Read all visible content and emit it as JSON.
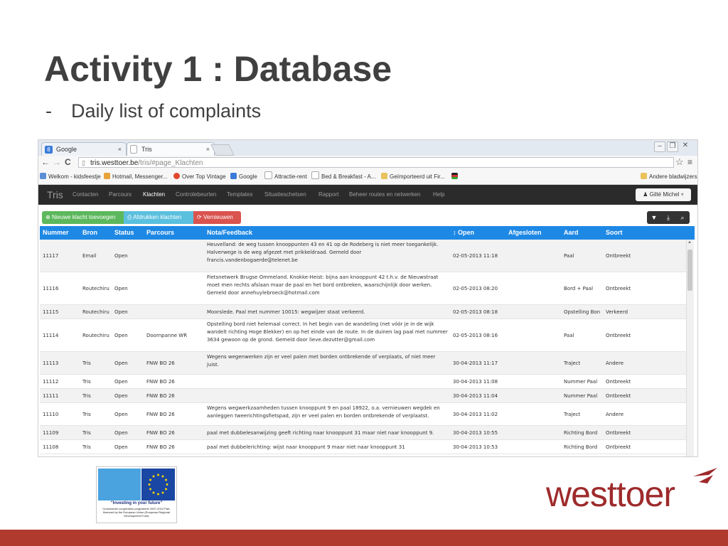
{
  "slide": {
    "title": "Activity 1 : Database",
    "bullet_dash": "-",
    "bullet": "Daily list of complaints"
  },
  "browser": {
    "tabs": [
      {
        "label": "Google",
        "favicon": "google-icon",
        "close": "×"
      },
      {
        "label": "Tris",
        "favicon": "page-icon",
        "close": "×"
      }
    ],
    "url_host": "tris.westtoer.be",
    "url_path": "/tris/#page_Klachten",
    "bookmarks": [
      "Welkom - kidsfeestje",
      "Hotmail, Messenger...",
      "Over Top Vintage",
      "Google",
      "Attractie-rent",
      "Bed & Breakfast - A...",
      "Geïmporteerd uit Fir...",
      "Andere bladwijzers"
    ]
  },
  "app": {
    "brand": "Tris",
    "menu": [
      "Contacten",
      "Parcours",
      "Klachten",
      "Controlebeurten",
      "Templates",
      "Situatieschetsen",
      "Rapport",
      "Beheer routes en netwerken",
      "Help"
    ],
    "active_menu": "Klachten",
    "user": "Gilté Michel",
    "buttons": {
      "new": "Nieuwe klacht toevoegen",
      "print": "Afdrukken klachten",
      "refresh": "Vernieuwen"
    }
  },
  "table": {
    "columns": [
      "Nummer",
      "Bron",
      "Status",
      "Parcours",
      "Nota/Feedback",
      "Open",
      "Afgesloten",
      "Aard",
      "Soort"
    ],
    "rows": [
      {
        "nummer": "11117",
        "bron": "Email",
        "status": "Open",
        "parcours": "",
        "nota": "Heuvelland: de weg tussen knooppunten 43 en 41 op de Rodeberg is niet meer toegankelijk. Halverwege is de weg afgezet met prikkeldraad. Gemeld door francis.vandenbogaerde@telenet.be",
        "open": "02-05-2013 11:18",
        "afgesloten": "",
        "aard": "Paal",
        "soort": "Ontbreekt"
      },
      {
        "nummer": "11116",
        "bron": "Routechiru",
        "status": "Open",
        "parcours": "",
        "nota": "Fietsnetwerk Brugse Ommeland. Knokke-Heist: bijna aan knooppunt 42 t.h.v. de Nieuwstraat moet men rechts afslaan maar de paal en het bord ontbreken, waarschijnlijk door werken. Gemeld door annehuylebroeck@hotmail.com",
        "open": "02-05-2013 08:20",
        "afgesloten": "",
        "aard": "Bord + Paal",
        "soort": "Ontbreekt"
      },
      {
        "nummer": "11115",
        "bron": "Routechiru",
        "status": "Open",
        "parcours": "",
        "nota": "Moorslede. Paal met nummer 10015: wegwijzer staat verkeerd.",
        "open": "02-05-2013 08:18",
        "afgesloten": "",
        "aard": "Opstelling Bon",
        "soort": "Verkeerd"
      },
      {
        "nummer": "11114",
        "bron": "Routechiru",
        "status": "Open",
        "parcours": "Doornpanne WR",
        "nota": "Opstelling bord niet helemaal correct. In het begin van de wandeling (net vóór je in de wijk wandelt richting Hoge Blekker) en op het einde van de route. In de duinen lag paal met nummer 3634 gewoon op de grond. Gemeld door lieve.dezutter@gmail.com",
        "open": "02-05-2013 08:16",
        "afgesloten": "",
        "aard": "Paal",
        "soort": "Ontbreekt"
      },
      {
        "nummer": "11113",
        "bron": "Tris",
        "status": "Open",
        "parcours": "FNW BO 26",
        "nota": "Wegens wegenwerken zijn er veel palen met borden ontbrekende of verplaats, of niet meer juist.",
        "open": "30-04-2013 11:17",
        "afgesloten": "",
        "aard": "Traject",
        "soort": "Andere"
      },
      {
        "nummer": "11112",
        "bron": "Tris",
        "status": "Open",
        "parcours": "FNW BO 26",
        "nota": "",
        "open": "30-04-2013 11:08",
        "afgesloten": "",
        "aard": "Nummer Paal",
        "soort": "Ontbreekt"
      },
      {
        "nummer": "11111",
        "bron": "Tris",
        "status": "Open",
        "parcours": "FNW BO 26",
        "nota": "",
        "open": "30-04-2013 11:04",
        "afgesloten": "",
        "aard": "Nummer Paal",
        "soort": "Ontbreekt"
      },
      {
        "nummer": "11110",
        "bron": "Tris",
        "status": "Open",
        "parcours": "FNW BO 26",
        "nota": "Wegens wegwerkzaamheden tussen knooppunt 9 en paal 18922, o.a. vernieuwen wegdek en aanleggen tweerichtingsfietspad, zijn er veel palen en borden ontbrekende of verplaatst.",
        "open": "30-04-2013 11:02",
        "afgesloten": "",
        "aard": "Traject",
        "soort": "Andere"
      },
      {
        "nummer": "11109",
        "bron": "Tris",
        "status": "Open",
        "parcours": "FNW BO 26",
        "nota": "paal met dubbelesanwijzing geeft richting naar knooppunt 31 maar niet naar knooppunt 9.",
        "open": "30-04-2013 10:55",
        "afgesloten": "",
        "aard": "Richting Bord",
        "soort": "Ontbreekt"
      },
      {
        "nummer": "11108",
        "bron": "Tris",
        "status": "Open",
        "parcours": "FNW BO 26",
        "nota": "paal met dubbelerichting: wijst naar knooppunt 9 maar niet naar knooppunt 31",
        "open": "30-04-2013 10:53",
        "afgesloten": "",
        "aard": "Richting Bord",
        "soort": "Ontbreekt"
      }
    ]
  },
  "eu_logo": {
    "line1": "\"Investing in your future\"",
    "line2": "Crossborder cooperation programme 2007-2013 Part-financed by the European Union (European Regional Development Fund)"
  },
  "logo": {
    "text": "westtoer"
  },
  "colors": {
    "accent": "#1e88e5",
    "brand_red": "#9e2a2b",
    "footer": "#b03a2e"
  }
}
